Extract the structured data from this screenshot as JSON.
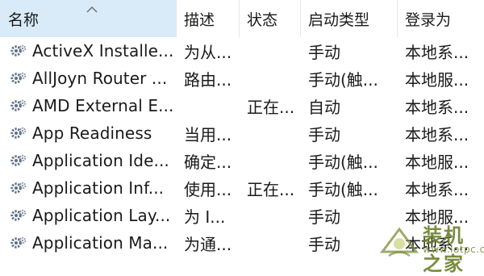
{
  "columns": [
    {
      "key": "name",
      "label": "名称",
      "sorted": true
    },
    {
      "key": "desc",
      "label": "描述"
    },
    {
      "key": "status",
      "label": "状态"
    },
    {
      "key": "start",
      "label": "启动类型"
    },
    {
      "key": "logon",
      "label": "登录为"
    }
  ],
  "rows": [
    {
      "name": "ActiveX Installe...",
      "desc": "为从...",
      "status": "",
      "start": "手动",
      "logon": "本地系..."
    },
    {
      "name": "AllJoyn Router ...",
      "desc": "路由...",
      "status": "",
      "start": "手动(触...",
      "logon": "本地服..."
    },
    {
      "name": "AMD External E...",
      "desc": "",
      "status": "正在...",
      "start": "自动",
      "logon": "本地系..."
    },
    {
      "name": "App Readiness",
      "desc": "当用...",
      "status": "",
      "start": "手动",
      "logon": "本地系..."
    },
    {
      "name": "Application Ide...",
      "desc": "确定...",
      "status": "",
      "start": "手动(触...",
      "logon": "本地服..."
    },
    {
      "name": "Application Inf...",
      "desc": "使用...",
      "status": "正在...",
      "start": "手动(触...",
      "logon": "本地系..."
    },
    {
      "name": "Application Lay...",
      "desc": "为 I...",
      "status": "",
      "start": "手动",
      "logon": "本地服..."
    },
    {
      "name": "Application Ma...",
      "desc": "为通...",
      "status": "",
      "start": "手动",
      "logon": "本地系..."
    }
  ],
  "watermark": {
    "cn": "装机之家",
    "en": "www.lotpc.com"
  },
  "icons": {
    "row_icon": "gear-icon",
    "sort": "sort-ascending-icon"
  }
}
